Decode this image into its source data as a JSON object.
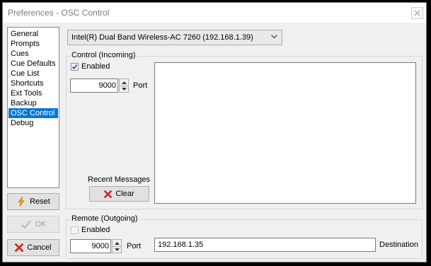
{
  "window": {
    "title": "Preferences - OSC Control"
  },
  "sidebar": {
    "items": [
      {
        "label": "General"
      },
      {
        "label": "Prompts"
      },
      {
        "label": "Cues"
      },
      {
        "label": "Cue Defaults"
      },
      {
        "label": "Cue List"
      },
      {
        "label": "Shortcuts"
      },
      {
        "label": "Ext Tools"
      },
      {
        "label": "Backup"
      },
      {
        "label": "OSC Control"
      },
      {
        "label": "Debug"
      }
    ],
    "selected": "OSC Control"
  },
  "buttons": {
    "reset": "Reset",
    "ok": "OK",
    "cancel": "Cancel"
  },
  "network_adapter": {
    "selected": "Intel(R) Dual Band Wireless-AC 7260 (192.168.1.39)"
  },
  "control_incoming": {
    "group_label": "Control (Incoming)",
    "enabled_label": "Enabled",
    "enabled": true,
    "port_value": "9000",
    "port_label": "Port",
    "recent_messages_label": "Recent Messages",
    "clear_label": "Clear"
  },
  "remote_outgoing": {
    "group_label": "Remote (Outgoing)",
    "enabled_label": "Enabled",
    "enabled": false,
    "port_value": "9000",
    "port_label": "Port",
    "destination_value": "192.168.1.35",
    "destination_label": "Destination"
  },
  "colors": {
    "selection": "#0078d7",
    "window_bg": "#f0f0f0",
    "reset_icon": "#f0a000",
    "cancel_icon": "#d42020",
    "clear_icon": "#d42020"
  },
  "icons": {
    "reset": "lightning-icon",
    "ok": "checkmark-icon",
    "cancel": "x-icon",
    "clear": "x-icon",
    "close": "close-icon",
    "dropdown": "chevron-down-icon"
  }
}
